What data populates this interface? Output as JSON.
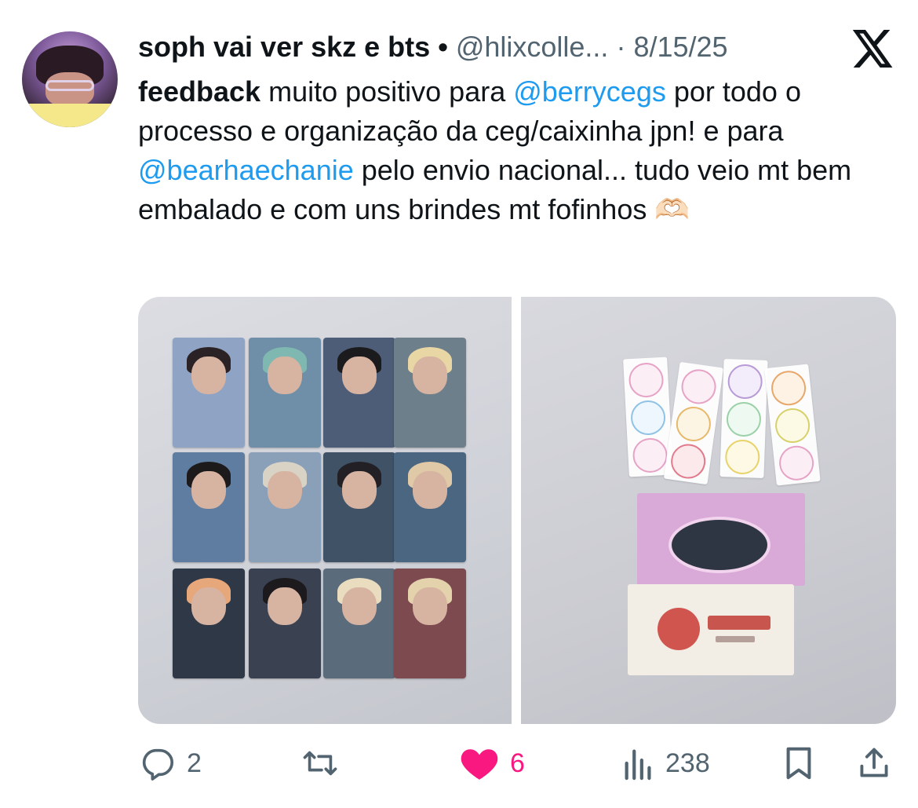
{
  "tweet": {
    "author_name": "soph vai ver skz e bts",
    "separator_dot": "•",
    "handle": "@hlixcolle...",
    "date_separator": "·",
    "date": "8/15/25",
    "text_parts": {
      "bold": "feedback",
      "t1": " muito positivo para ",
      "mention1": "@berrycegs",
      "t2": " por todo o processo e organização da ceg/caixinha jpn! e para ",
      "mention2": "@bearhaechanie",
      "t3": " pelo envio nacional... tudo veio mt bem embalado e com uns brindes mt fofinhos ",
      "emoji": "🫶🏻"
    },
    "media_count": 2
  },
  "actions": {
    "reply_count": "2",
    "retweet_count": "",
    "like_count": "6",
    "view_count": "238"
  },
  "icons": {
    "platform": "x-logo-icon",
    "reply": "reply-icon",
    "retweet": "retweet-icon",
    "like": "heart-icon",
    "views": "views-icon",
    "bookmark": "bookmark-icon",
    "share": "share-icon"
  },
  "colors": {
    "link": "#1d9bf0",
    "like": "#f91880",
    "secondary_text": "#536471",
    "text": "#0f1419"
  }
}
